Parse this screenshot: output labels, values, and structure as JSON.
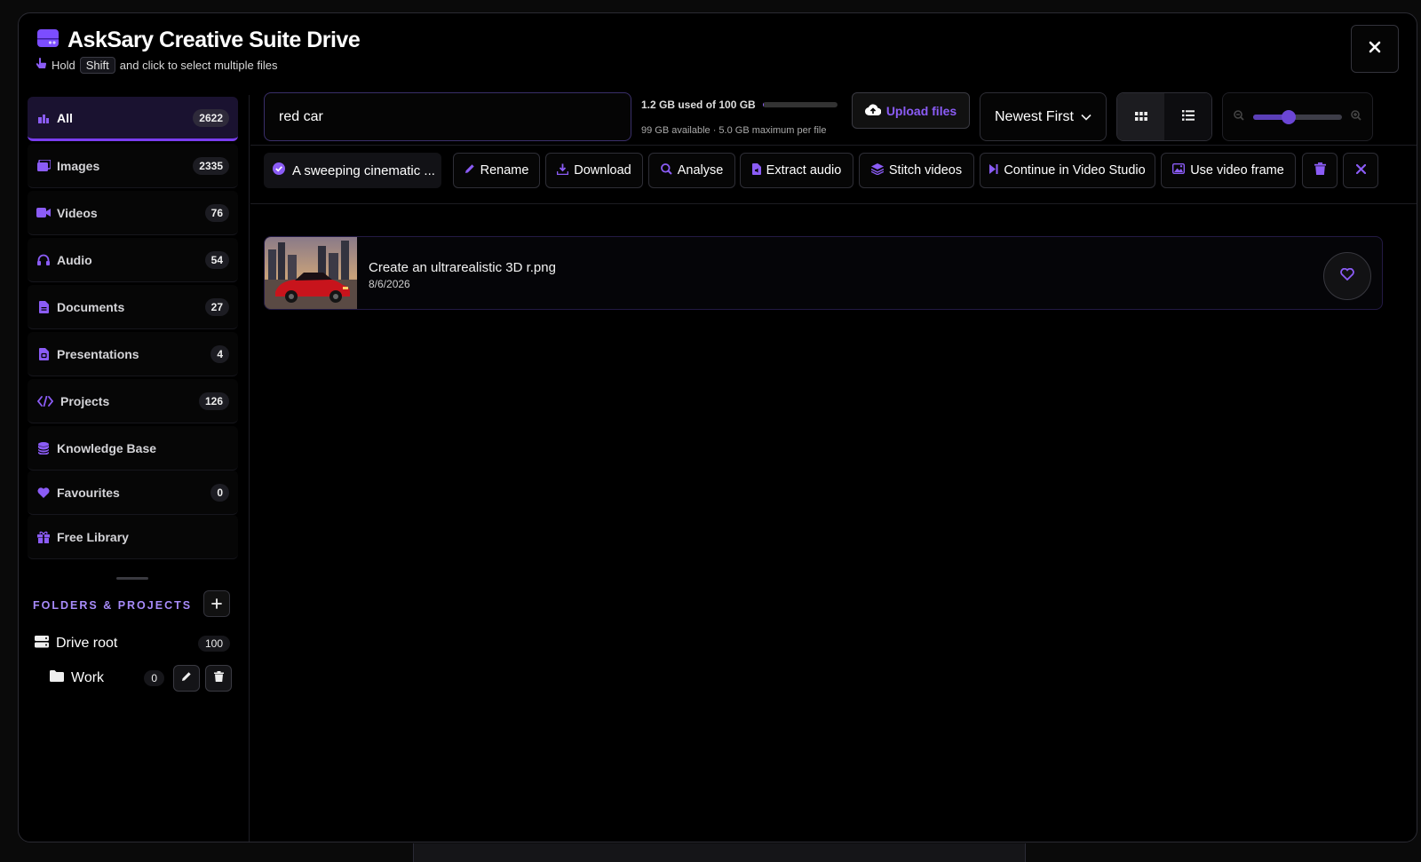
{
  "app": {
    "title": "AskSary Creative Suite Drive",
    "hint": {
      "prefix": "Hold",
      "key": "Shift",
      "suffix": "and click to select multiple files"
    },
    "accent": "#8b5cf6"
  },
  "sidebar": {
    "categories": [
      {
        "label": "All",
        "count": "2622",
        "icon": "files-icon"
      },
      {
        "label": "Images",
        "count": "2335",
        "icon": "images-icon"
      },
      {
        "label": "Videos",
        "count": "76",
        "icon": "video-icon"
      },
      {
        "label": "Audio",
        "count": "54",
        "icon": "headphones-icon"
      },
      {
        "label": "Documents",
        "count": "27",
        "icon": "document-icon"
      },
      {
        "label": "Presentations",
        "count": "4",
        "icon": "presentation-icon"
      },
      {
        "label": "Projects",
        "count": "126",
        "icon": "code-icon"
      },
      {
        "label": "Knowledge Base",
        "count": "",
        "icon": "database-icon"
      },
      {
        "label": "Favourites",
        "count": "0",
        "icon": "heart-icon"
      },
      {
        "label": "Free Library",
        "count": "",
        "icon": "gift-icon"
      }
    ],
    "folders_title": "FOLDERS & PROJECTS",
    "tree": {
      "root": {
        "label": "Drive root",
        "count": "100"
      },
      "folders": [
        {
          "label": "Work",
          "count": "0"
        }
      ]
    }
  },
  "toolbar": {
    "search_value": "red car",
    "storage": {
      "used": "1.2 GB used of 100 GB",
      "sub": "99 GB available · 5.0 GB maximum per file",
      "fraction": 0.012
    },
    "upload_label": "Upload files",
    "sort_value": "Newest First",
    "zoom_level": 0.4
  },
  "actions": {
    "selected_label": "A sweeping cinematic ...",
    "buttons": [
      {
        "label": "Rename",
        "icon": "pencil-icon"
      },
      {
        "label": "Download",
        "icon": "download-icon"
      },
      {
        "label": "Analyse",
        "icon": "magnify-icon"
      },
      {
        "label": "Extract audio",
        "icon": "file-audio-icon"
      },
      {
        "label": "Stitch videos",
        "icon": "layers-icon"
      },
      {
        "label": "Continue in Video Studio",
        "icon": "skip-forward-icon"
      },
      {
        "label": "Use video frame",
        "icon": "image-icon"
      }
    ]
  },
  "files": [
    {
      "name": "Create an ultrarealistic 3D r.png",
      "date": "8/6/2026"
    }
  ]
}
